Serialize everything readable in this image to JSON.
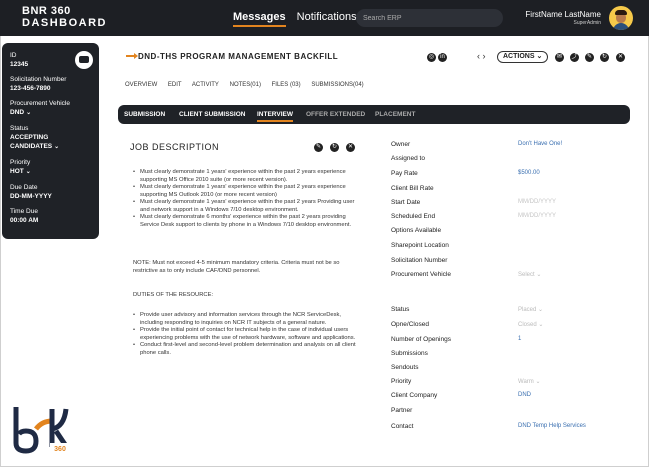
{
  "brand": {
    "line1": "BNR 360",
    "line2": "DASHBOARD"
  },
  "topnav": {
    "messages": "Messages",
    "notifications": "Notifications"
  },
  "search": {
    "placeholder": "Search ERP"
  },
  "user": {
    "name": "FirstName LastName",
    "role": "SuperAdmin"
  },
  "sidebar": {
    "id_label": "ID",
    "id_value": "12345",
    "solicitation_label": "Solicitation Number",
    "solicitation_value": "123-456-7890",
    "vehicle_label": "Procurement Vehicle",
    "vehicle_value": "DND",
    "status_label": "Status",
    "status_value": "ACCEPTING CANDIDATES",
    "priority_label": "Priority",
    "priority_value": "HOT",
    "due_date_label": "Due Date",
    "due_date_value": "DD-MM-YYYY",
    "time_due_label": "Time Due",
    "time_due_value": "00:00 AM"
  },
  "header": {
    "title": "DND-THS PROGRAM MANAGEMENT BACKFILL",
    "actions_label": "ACTIONS"
  },
  "tabs": [
    "OVERVIEW",
    "EDIT",
    "ACTIVITY",
    "NOTES(01)",
    "FILES (03)",
    "SUBMISSIONS(04)"
  ],
  "tabbar": [
    "SUBMISSION",
    "CLIENT SUBMISSION",
    "INTERVIEW",
    "OFFER EXTENDED",
    "PLACEMENT"
  ],
  "job": {
    "title": "JOB DESCRIPTION",
    "requirements": [
      "Must clearly demonstrate 1 years' experience within the past 2 years experience supporting MS Office 2010 suite (or more recent version).",
      "Must clearly demonstrate 1 years' experience within the past 2 years experience supporting MS Outlook 2010 (or more recent version)",
      "Must clearly demonstrate 1 years' experience within the past 2 years Providing user and network support in a Windows 7/10 desktop environment.",
      "Must clearly demonstrate 6 months' experience within the past 2 years providing Service Desk support to clients by phone in a Windows 7/10 desktop environment."
    ],
    "note": "NOTE: Must not exceed 4-5 minimum mandatory criteria. Criteria must not be so restrictive as to only include CAF/DND personnel.",
    "duties_title": "DUTIES OF THE RESOURCE:",
    "duties": [
      "Provide user advisory and information services through the NCR ServiceDesk, including responding to inquiries on NCR IT subjects of a general nature.",
      "Provide the initial point of contact for technical help in the case of individual users experiencing problems with the use of network hardware, software and applications.",
      "Conduct first-level and second-level problem determination and analysis on all client phone calls."
    ]
  },
  "details": {
    "owner_label": "Owner",
    "owner_value": "Don't Have One!",
    "assigned_label": "Assigned to",
    "pay_rate_label": "Pay Rate",
    "pay_rate_value": "$500.00",
    "bill_rate_label": "Client Bill Rate",
    "start_date_label": "Start Date",
    "start_date_value": "MM/DD/YYYY",
    "scheduled_end_label": "Scheduled End",
    "scheduled_end_value": "MM/DD/YYYY",
    "options_label": "Options Available",
    "sharepoint_label": "Sharepoint Location",
    "solicitation_label": "Solicitation Number",
    "vehicle_label": "Procurement Vehicle",
    "vehicle_value": "Select",
    "status_label": "Status",
    "status_value": "Placed",
    "open_closed_label": "Opne/Closed",
    "open_closed_value": "Closed",
    "openings_label": "Number of Openings",
    "openings_value": "1",
    "submissions_label": "Submissions",
    "sendouts_label": "Sendouts",
    "priority_label": "Priority",
    "priority_value": "Warm",
    "company_label": "Client Company",
    "company_value": "DND",
    "partner_label": "Partner",
    "contact_label": "Contact",
    "contact_value": "DND Temp Help Services"
  },
  "logo": {
    "number": "360"
  },
  "colors": {
    "accent": "#e2841f",
    "dark": "#1f2227",
    "link": "#3a6fb0"
  }
}
